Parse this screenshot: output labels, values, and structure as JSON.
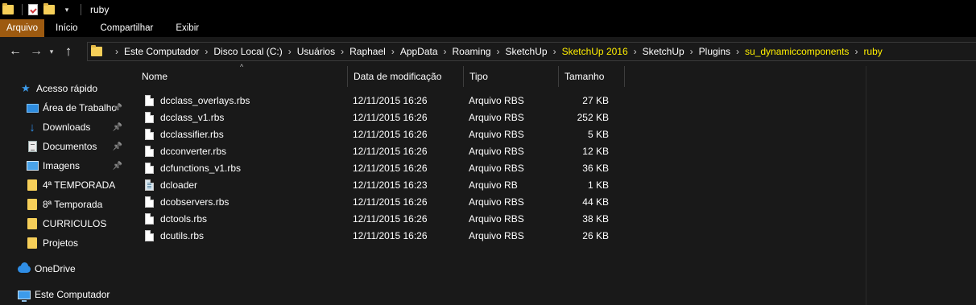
{
  "window": {
    "title": "ruby"
  },
  "quick_access_toolbar": {
    "icons": [
      "folder-icon",
      "properties-icon",
      "new-folder-icon",
      "customize-dropdown-icon"
    ]
  },
  "ribbon": {
    "tabs": [
      {
        "label": "Arquivo",
        "active": true
      },
      {
        "label": "Início"
      },
      {
        "label": "Compartilhar"
      },
      {
        "label": "Exibir"
      }
    ]
  },
  "address": {
    "crumbs": [
      {
        "label": "Este Computador",
        "highlight": false
      },
      {
        "label": "Disco Local (C:)",
        "highlight": false
      },
      {
        "label": "Usuários",
        "highlight": false
      },
      {
        "label": "Raphael",
        "highlight": false
      },
      {
        "label": "AppData",
        "highlight": false
      },
      {
        "label": "Roaming",
        "highlight": false
      },
      {
        "label": "SketchUp",
        "highlight": false
      },
      {
        "label": "SketchUp 2016",
        "highlight": true
      },
      {
        "label": "SketchUp",
        "highlight": false
      },
      {
        "label": "Plugins",
        "highlight": false
      },
      {
        "label": "su_dynamiccomponents",
        "highlight": true
      },
      {
        "label": "ruby",
        "highlight": true
      }
    ],
    "highlight_color": "#ffef00"
  },
  "nav": {
    "items": [
      {
        "label": "Acesso rápido",
        "icon": "star-icon",
        "pinned": false
      },
      {
        "label": "Área de Trabalho",
        "icon": "desktop-icon",
        "pinned": true
      },
      {
        "label": "Downloads",
        "icon": "download-icon",
        "pinned": true
      },
      {
        "label": "Documentos",
        "icon": "document-icon",
        "pinned": true
      },
      {
        "label": "Imagens",
        "icon": "pictures-icon",
        "pinned": true
      },
      {
        "label": "4ª TEMPORADA",
        "icon": "folder-icon",
        "pinned": false
      },
      {
        "label": "8ª Temporada",
        "icon": "folder-icon",
        "pinned": false
      },
      {
        "label": "CURRICULOS",
        "icon": "folder-icon",
        "pinned": false
      },
      {
        "label": "Projetos",
        "icon": "folder-icon",
        "pinned": false
      },
      {
        "label": "OneDrive",
        "icon": "onedrive-icon",
        "pinned": false
      },
      {
        "label": "Este Computador",
        "icon": "computer-icon",
        "pinned": false
      }
    ]
  },
  "files": {
    "columns": {
      "name": "Nome",
      "date": "Data de modificação",
      "type": "Tipo",
      "size": "Tamanho"
    },
    "rows": [
      {
        "name": "dcclass_overlays.rbs",
        "date": "12/11/2015 16:26",
        "type": "Arquivo RBS",
        "size": "27 KB",
        "icon": "rbs-file-icon"
      },
      {
        "name": "dcclass_v1.rbs",
        "date": "12/11/2015 16:26",
        "type": "Arquivo RBS",
        "size": "252 KB",
        "icon": "rbs-file-icon"
      },
      {
        "name": "dcclassifier.rbs",
        "date": "12/11/2015 16:26",
        "type": "Arquivo RBS",
        "size": "5 KB",
        "icon": "rbs-file-icon"
      },
      {
        "name": "dcconverter.rbs",
        "date": "12/11/2015 16:26",
        "type": "Arquivo RBS",
        "size": "12 KB",
        "icon": "rbs-file-icon"
      },
      {
        "name": "dcfunctions_v1.rbs",
        "date": "12/11/2015 16:26",
        "type": "Arquivo RBS",
        "size": "36 KB",
        "icon": "rbs-file-icon"
      },
      {
        "name": "dcloader",
        "date": "12/11/2015 16:23",
        "type": "Arquivo RB",
        "size": "1 KB",
        "icon": "rb-file-icon"
      },
      {
        "name": "dcobservers.rbs",
        "date": "12/11/2015 16:26",
        "type": "Arquivo RBS",
        "size": "44 KB",
        "icon": "rbs-file-icon"
      },
      {
        "name": "dctools.rbs",
        "date": "12/11/2015 16:26",
        "type": "Arquivo RBS",
        "size": "38 KB",
        "icon": "rbs-file-icon"
      },
      {
        "name": "dcutils.rbs",
        "date": "12/11/2015 16:26",
        "type": "Arquivo RBS",
        "size": "26 KB",
        "icon": "rbs-file-icon"
      }
    ]
  }
}
